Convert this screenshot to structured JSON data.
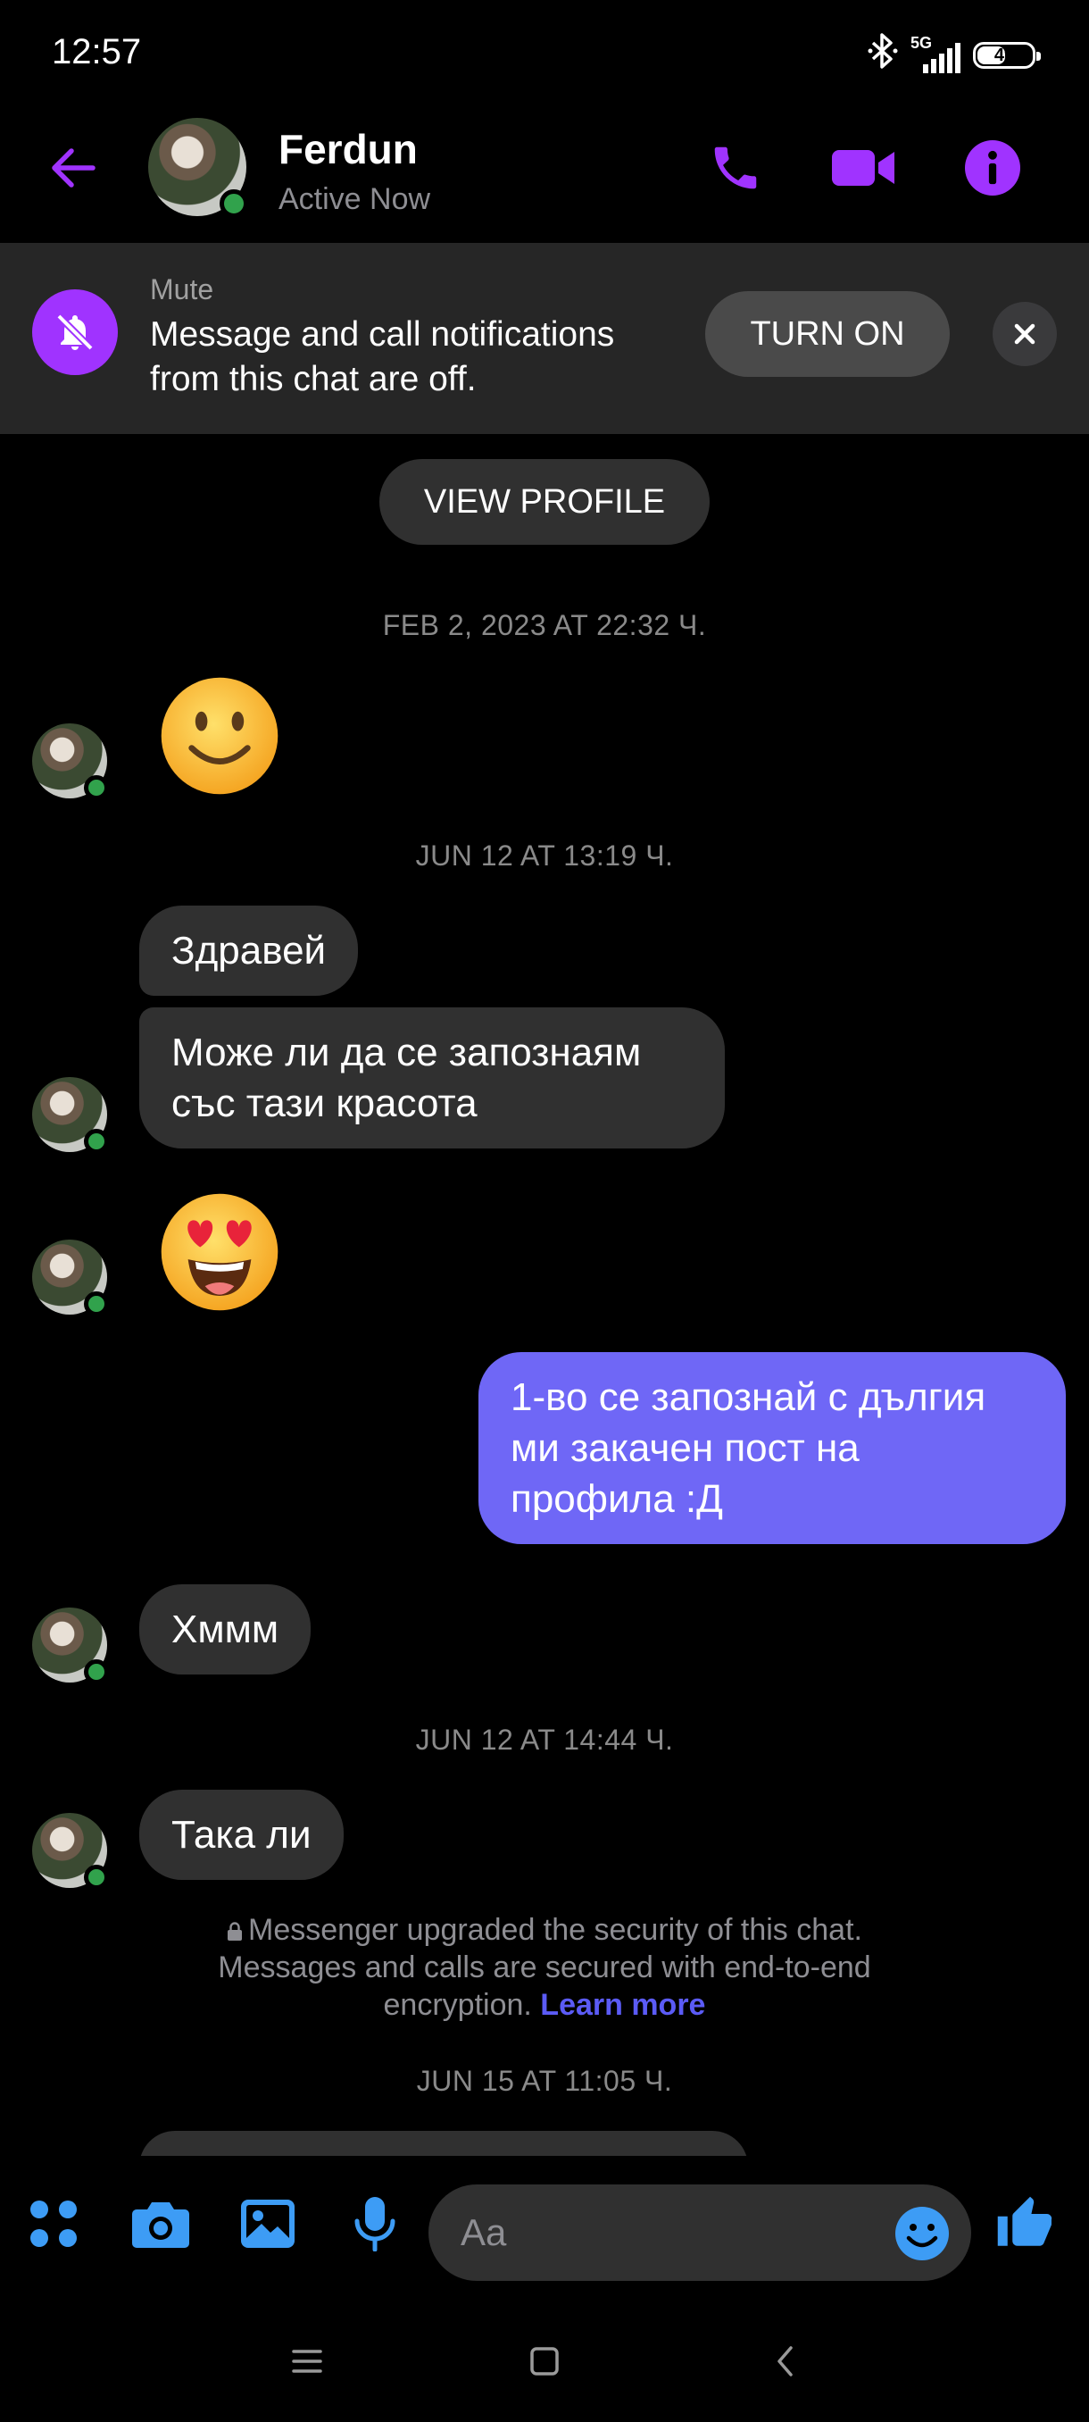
{
  "status_bar": {
    "time": "12:57",
    "network": "5G",
    "battery": "49"
  },
  "header": {
    "name": "Ferdun",
    "status": "Active Now",
    "accent_color": "#a033ff"
  },
  "mute_banner": {
    "title": "Mute",
    "text": "Message and call notifications from this chat are off.",
    "turn_on_label": "TURN ON"
  },
  "chat": {
    "view_profile_label": "VIEW PROFILE",
    "timestamps": [
      "FEB 2, 2023 AT 22:32 Ч.",
      "JUN 12 AT 13:19 Ч.",
      "JUN 12 AT 14:44 Ч.",
      "JUN 15 AT 11:05 Ч."
    ],
    "messages": [
      {
        "from": "them",
        "type": "emoji",
        "content": "slightly-smiling-face"
      },
      {
        "from": "them",
        "type": "text",
        "content": "Здравей"
      },
      {
        "from": "them",
        "type": "text",
        "content": "Може ли да се запознаям със тази красота"
      },
      {
        "from": "them",
        "type": "emoji",
        "content": "heart-eyes-face"
      },
      {
        "from": "me",
        "type": "text",
        "content": "1-во се запознай с дългия ми закачен пост на профила :Д"
      },
      {
        "from": "them",
        "type": "text",
        "content": "Хммм"
      },
      {
        "from": "them",
        "type": "text",
        "content": "Така ли"
      }
    ],
    "security_note": "Messenger upgraded the security of this chat. Messages and calls are secured with end-to-end encryption.",
    "learn_more": "Learn more",
    "outgoing_color": "#6f67f6",
    "incoming_color": "#303030"
  },
  "composer": {
    "placeholder": "Aa",
    "icon_color": "#3d9cf5"
  }
}
